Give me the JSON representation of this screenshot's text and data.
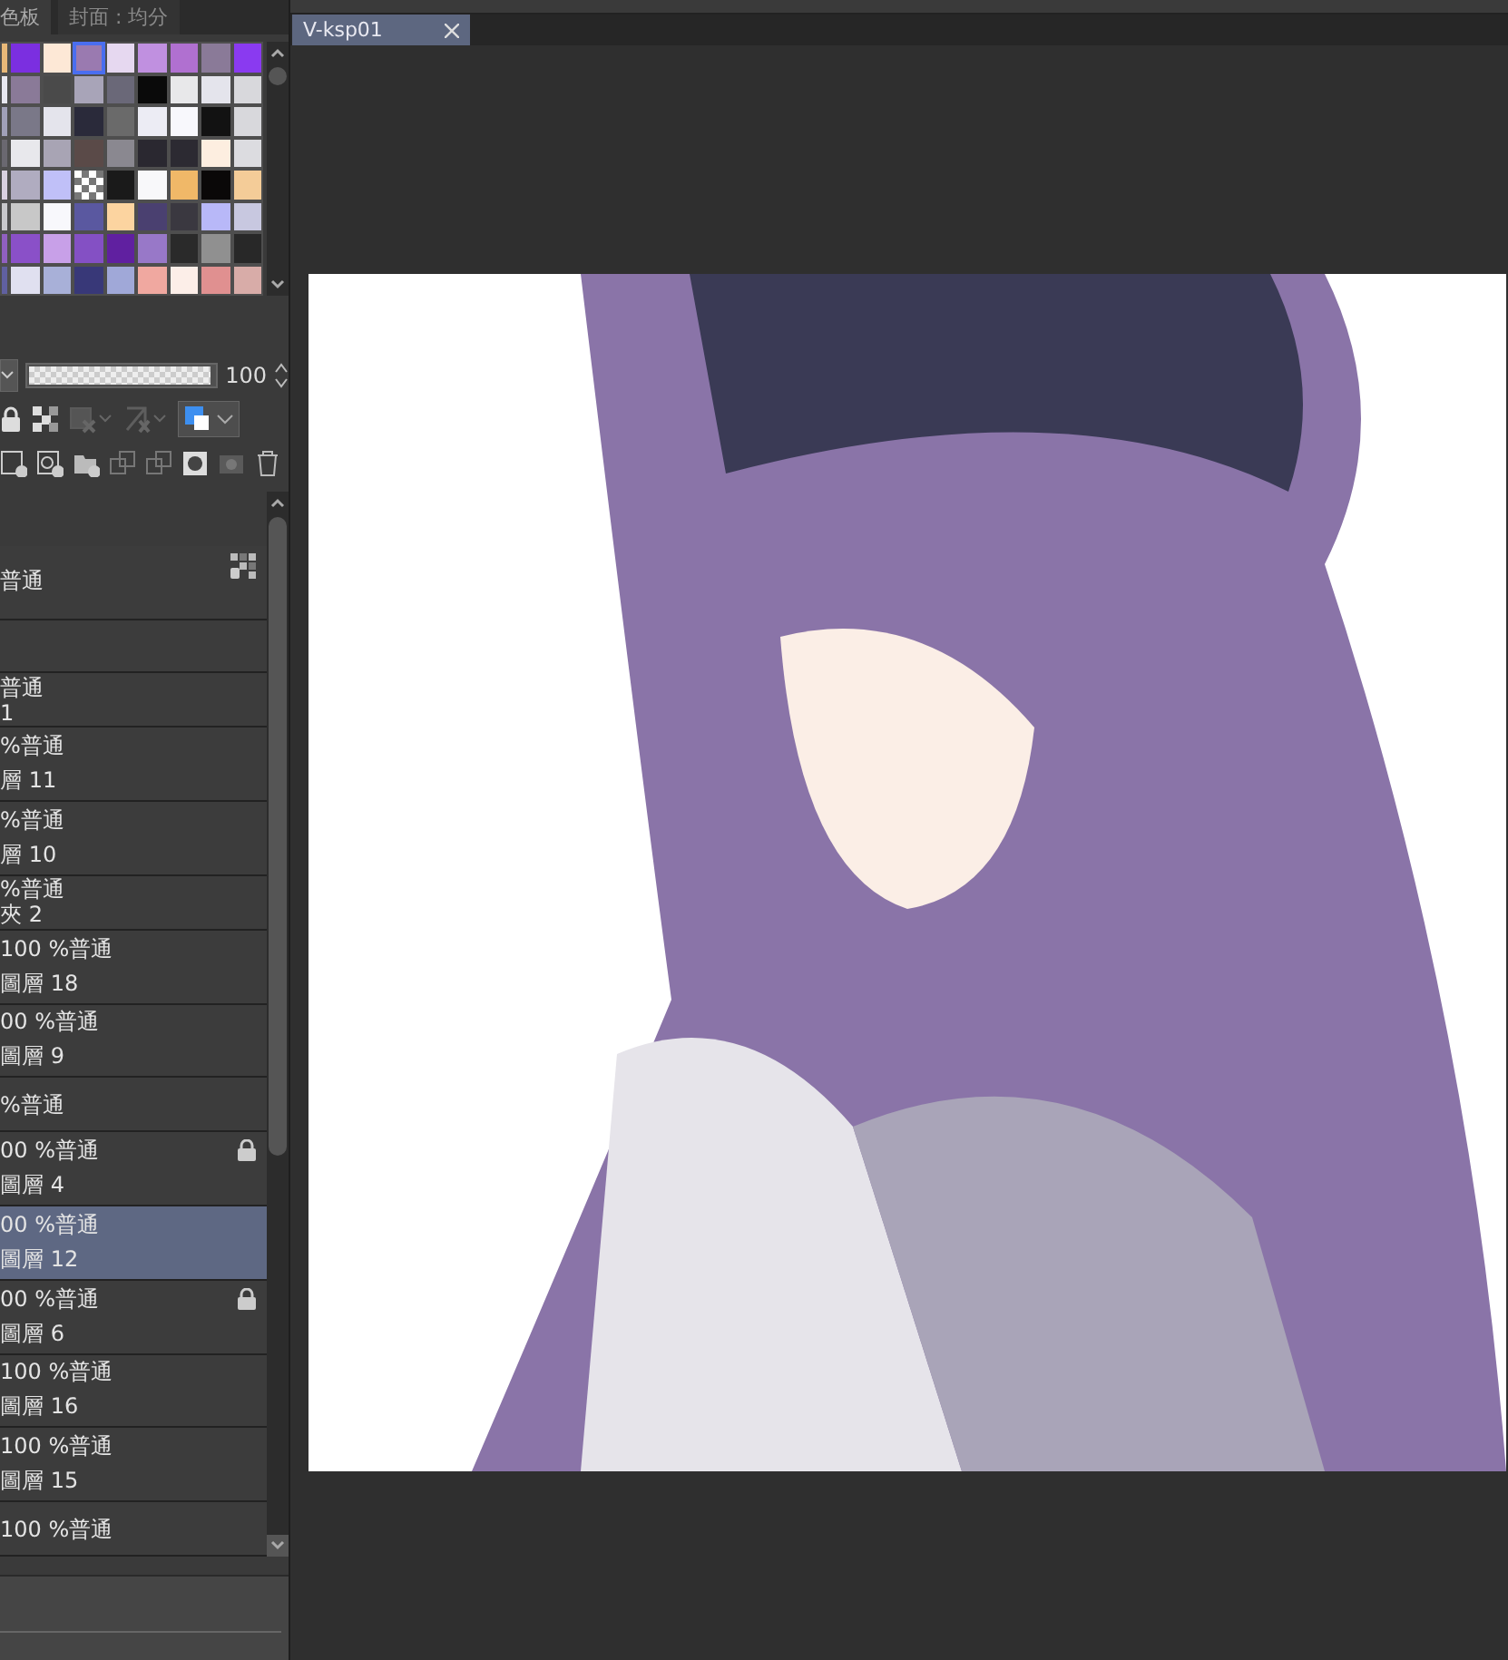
{
  "panel_tabs": [
    {
      "label": "色板",
      "selected": true
    },
    {
      "label": "封面 : 均分",
      "selected": false
    }
  ],
  "palette": {
    "rows": [
      [
        {
          "color": "#e8b878",
          "selected": false,
          "kind": "color"
        },
        {
          "color": "#7b2fe0",
          "selected": false,
          "kind": "color"
        },
        {
          "color": "#fde8d6",
          "selected": false,
          "kind": "color"
        },
        {
          "color": "#9a7ab0",
          "selected": true,
          "kind": "color"
        },
        {
          "color": "#e6d8f0",
          "selected": false,
          "kind": "color"
        },
        {
          "color": "#c090e0",
          "selected": false,
          "kind": "color"
        },
        {
          "color": "#b070d0",
          "selected": false,
          "kind": "color"
        },
        {
          "color": "#8a7a98",
          "selected": false,
          "kind": "color"
        },
        {
          "color": "#8a3af0",
          "selected": false,
          "kind": "color"
        }
      ],
      [
        {
          "color": "#e8e8f0",
          "selected": false,
          "kind": "color"
        },
        {
          "color": "#8a7a98",
          "selected": false,
          "kind": "color"
        },
        {
          "color": "#4a4a4a",
          "selected": false,
          "kind": "color"
        },
        {
          "color": "#a8a4b8",
          "selected": false,
          "kind": "color"
        },
        {
          "color": "#6a6878",
          "selected": false,
          "kind": "color"
        },
        {
          "color": "#0a0a0a",
          "selected": false,
          "kind": "color"
        },
        {
          "color": "#e8e8ea",
          "selected": false,
          "kind": "color"
        },
        {
          "color": "#e4e4ec",
          "selected": false,
          "kind": "color"
        },
        {
          "color": "#d8d8dc",
          "selected": false,
          "kind": "color"
        }
      ],
      [
        {
          "color": "#a0a0b8",
          "selected": false,
          "kind": "color"
        },
        {
          "color": "#7a7888",
          "selected": false,
          "kind": "color"
        },
        {
          "color": "#e4e4ec",
          "selected": false,
          "kind": "color"
        },
        {
          "color": "#2a2a3a",
          "selected": false,
          "kind": "color"
        },
        {
          "color": "#6a6a6a",
          "selected": false,
          "kind": "color"
        },
        {
          "color": "#ececf4",
          "selected": false,
          "kind": "color"
        },
        {
          "color": "#f8f8fc",
          "selected": false,
          "kind": "color"
        },
        {
          "color": "#121212",
          "selected": false,
          "kind": "color"
        },
        {
          "color": "#d8d8dc",
          "selected": false,
          "kind": "color"
        }
      ],
      [
        {
          "color": "#6a6870",
          "selected": false,
          "kind": "color"
        },
        {
          "color": "#e8e8ec",
          "selected": false,
          "kind": "color"
        },
        {
          "color": "#a8a4b4",
          "selected": false,
          "kind": "color"
        },
        {
          "color": "#5a4a48",
          "selected": false,
          "kind": "color"
        },
        {
          "color": "#8a8890",
          "selected": false,
          "kind": "color"
        },
        {
          "color": "#2a2830",
          "selected": false,
          "kind": "color"
        },
        {
          "color": "#2c2a32",
          "selected": false,
          "kind": "color"
        },
        {
          "color": "#fdeee0",
          "selected": false,
          "kind": "color"
        },
        {
          "color": "#dcdce0",
          "selected": false,
          "kind": "color"
        }
      ],
      [
        {
          "color": "#d8d0e0",
          "selected": false,
          "kind": "color"
        },
        {
          "color": "#b0acc0",
          "selected": false,
          "kind": "color"
        },
        {
          "color": "#c0c0f8",
          "selected": false,
          "kind": "color"
        },
        {
          "selected": false,
          "kind": "transparent"
        },
        {
          "color": "#1a1a1a",
          "selected": false,
          "kind": "color"
        },
        {
          "color": "#f8f8fa",
          "selected": false,
          "kind": "color"
        },
        {
          "color": "#f0b868",
          "selected": false,
          "kind": "color"
        },
        {
          "color": "#0a0808",
          "selected": false,
          "kind": "color"
        },
        {
          "color": "#f4cc98",
          "selected": false,
          "kind": "color"
        }
      ],
      [
        {
          "color": "#c8c8cc",
          "selected": false,
          "kind": "color"
        },
        {
          "color": "#c8c8c8",
          "selected": false,
          "kind": "color"
        },
        {
          "color": "#f8f8fc",
          "selected": false,
          "kind": "color"
        },
        {
          "color": "#5a58a0",
          "selected": false,
          "kind": "color"
        },
        {
          "color": "#fcd4a0",
          "selected": false,
          "kind": "color"
        },
        {
          "color": "#4a4070",
          "selected": false,
          "kind": "color"
        },
        {
          "color": "#3a3840",
          "selected": false,
          "kind": "color"
        },
        {
          "color": "#b8b8f8",
          "selected": false,
          "kind": "color"
        },
        {
          "color": "#c8c8e0",
          "selected": false,
          "kind": "color"
        }
      ],
      [
        {
          "color": "#9060c0",
          "selected": false,
          "kind": "color"
        },
        {
          "color": "#8a50c8",
          "selected": false,
          "kind": "color"
        },
        {
          "color": "#c8a0e8",
          "selected": false,
          "kind": "color"
        },
        {
          "color": "#8450c4",
          "selected": false,
          "kind": "color"
        },
        {
          "color": "#6020a0",
          "selected": false,
          "kind": "color"
        },
        {
          "color": "#9878c8",
          "selected": false,
          "kind": "color"
        },
        {
          "color": "#2a2a2a",
          "selected": false,
          "kind": "color"
        },
        {
          "color": "#909090",
          "selected": false,
          "kind": "color"
        },
        {
          "color": "#282828",
          "selected": false,
          "kind": "color"
        }
      ],
      [
        {
          "color": "#6060a0",
          "selected": false,
          "kind": "color"
        },
        {
          "color": "#e0e0f0",
          "selected": false,
          "kind": "color"
        },
        {
          "color": "#a8b0d8",
          "selected": false,
          "kind": "color"
        },
        {
          "color": "#383878",
          "selected": false,
          "kind": "color"
        },
        {
          "color": "#a0a8d8",
          "selected": false,
          "kind": "color"
        },
        {
          "color": "#f0a8a0",
          "selected": false,
          "kind": "color"
        },
        {
          "color": "#fceee8",
          "selected": false,
          "kind": "color"
        },
        {
          "color": "#e09090",
          "selected": false,
          "kind": "color"
        },
        {
          "color": "#d8aca8",
          "selected": false,
          "kind": "color"
        }
      ]
    ]
  },
  "layer_properties": {
    "opacity": {
      "level": 1,
      "reading": "100"
    }
  },
  "layers": [
    {
      "kind": "full",
      "mode": "普通",
      "selected": false,
      "locked": false,
      "transparency_locked": true
    },
    {
      "kind": "compact",
      "selected": false,
      "locked": false,
      "transparency_locked": false
    },
    {
      "kind": "compact",
      "mode": "普通",
      "name": "1",
      "selected": false,
      "locked": false,
      "transparency_locked": false
    },
    {
      "kind": "full",
      "mode": "%普通",
      "name": "層 11",
      "selected": false,
      "locked": false,
      "transparency_locked": false
    },
    {
      "kind": "full",
      "mode": "%普通",
      "name": "層 10",
      "selected": false,
      "locked": false,
      "transparency_locked": false
    },
    {
      "kind": "compact",
      "mode": "%普通",
      "name": "夾 2",
      "selected": false,
      "locked": false,
      "transparency_locked": false
    },
    {
      "kind": "full",
      "mode": "100 %普通",
      "name": "圖層 18",
      "selected": false,
      "locked": false,
      "transparency_locked": false
    },
    {
      "kind": "full",
      "mode": "00 %普通",
      "name": "圖層 9",
      "selected": false,
      "locked": false,
      "transparency_locked": false
    },
    {
      "kind": "compact",
      "mode": "%普通",
      "selected": false,
      "locked": false,
      "transparency_locked": false
    },
    {
      "kind": "full",
      "mode": "00 %普通",
      "name": "圖層 4",
      "selected": false,
      "locked": true,
      "transparency_locked": false
    },
    {
      "kind": "full",
      "mode": "00 %普通",
      "name": "圖層 12",
      "selected": true,
      "locked": false,
      "transparency_locked": false
    },
    {
      "kind": "full",
      "mode": "00 %普通",
      "name": "圖層 6",
      "selected": false,
      "locked": true,
      "transparency_locked": false
    },
    {
      "kind": "full",
      "mode": "100 %普通",
      "name": "圖層 16",
      "selected": false,
      "locked": false,
      "transparency_locked": false
    },
    {
      "kind": "full",
      "mode": "100 %普通",
      "name": "圖層 15",
      "selected": false,
      "locked": false,
      "transparency_locked": false
    },
    {
      "kind": "compact",
      "mode": "100 %普通",
      "selected": false,
      "locked": false,
      "transparency_locked": false
    }
  ],
  "canvas": {
    "tab": {
      "title": "V-ksp01",
      "selected": true
    }
  }
}
